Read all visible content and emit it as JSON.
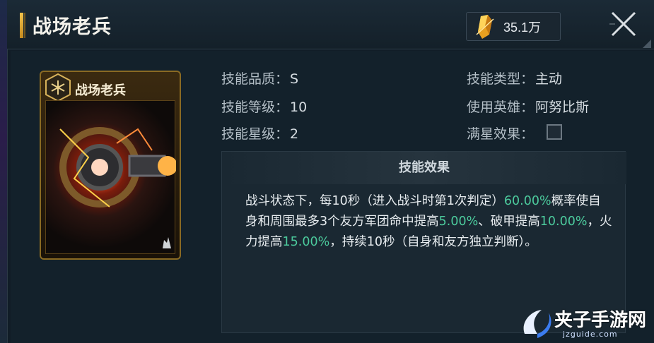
{
  "header": {
    "title": "战场老兵",
    "currency_value": "35.1万",
    "currency_icon": "gold-crystal-icon",
    "close_icon": "close-icon"
  },
  "card": {
    "name": "战场老兵",
    "emblem_icon": "hexagon-emblem-icon",
    "type_icon": "flame-badge-icon"
  },
  "info": {
    "quality_label": "技能品质：",
    "quality_value": "S",
    "level_label": "技能等级：",
    "level_value": "10",
    "star_label": "技能星级：",
    "star_value": "2",
    "type_label": "技能类型：",
    "type_value": "主动",
    "hero_label": "使用英雄：",
    "hero_value": "阿努比斯",
    "fullstar_label": "满星效果："
  },
  "effect": {
    "title": "技能效果",
    "seg1": "战斗状态下，每10秒（进入战斗时第1次判定）",
    "pct1": "60.00%",
    "seg2": "概率使自身和周围最多3个友方军团命中提高",
    "pct2": "5.00%",
    "seg3": "、破甲提高",
    "pct3": "10.00%",
    "seg4": "，火力提高",
    "pct4": "15.00%",
    "seg5": "，持续10秒（自身和友方独立判断）。"
  },
  "watermark": {
    "text": "夹子手游网",
    "sub": "jzguide.com"
  },
  "colors": {
    "accent_gold": "#f2c24b",
    "highlight_green": "#4ccb9d",
    "background": "#111d27"
  }
}
